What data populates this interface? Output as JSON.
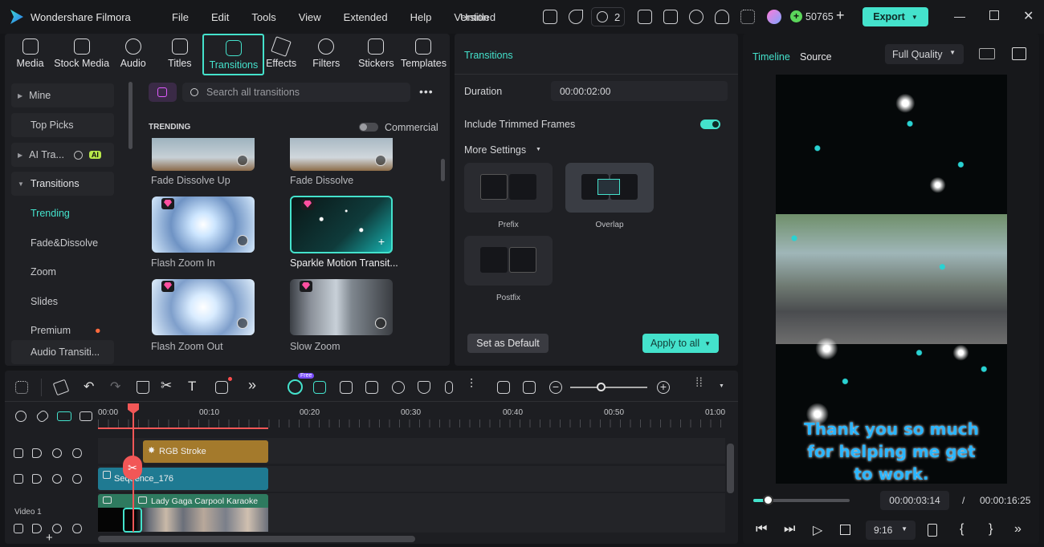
{
  "app": {
    "name": "Wondershare Filmora",
    "project": "Untitled"
  },
  "menu": [
    "File",
    "Edit",
    "Tools",
    "View",
    "Extended",
    "Help",
    "Version"
  ],
  "topbar": {
    "notification_count": "2",
    "credits": "50765",
    "export_label": "Export"
  },
  "media_tabs": [
    {
      "label": "Media",
      "icon": "media-icon"
    },
    {
      "label": "Stock Media",
      "icon": "stock-media-icon"
    },
    {
      "label": "Audio",
      "icon": "audio-icon"
    },
    {
      "label": "Titles",
      "icon": "titles-icon"
    },
    {
      "label": "Transitions",
      "icon": "transitions-icon"
    },
    {
      "label": "Effects",
      "icon": "effects-icon"
    },
    {
      "label": "Filters",
      "icon": "filters-icon"
    },
    {
      "label": "Stickers",
      "icon": "stickers-icon"
    },
    {
      "label": "Templates",
      "icon": "templates-icon"
    }
  ],
  "sidebar": {
    "items": [
      "Mine",
      "Top Picks",
      "AI Tra...",
      "Transitions",
      "Trending",
      "Fade&Dissolve",
      "Zoom",
      "Slides",
      "Premium",
      "Audio Transiti..."
    ],
    "ai_badge": "AI"
  },
  "library": {
    "search_placeholder": "Search all transitions",
    "section": "TRENDING",
    "commercial_label": "Commercial",
    "items": [
      "Fade Dissolve Up",
      "Fade Dissolve",
      "Flash Zoom In",
      "Sparkle Motion Transit...",
      "Flash Zoom Out",
      "Slow Zoom"
    ]
  },
  "props": {
    "title": "Transitions",
    "duration_label": "Duration",
    "duration_value": "00:00:02:00",
    "include_trimmed": "Include Trimmed Frames",
    "include_trimmed_on": true,
    "more_settings": "More Settings",
    "options": [
      "Prefix",
      "Overlap",
      "Postfix"
    ],
    "selected_option": "Overlap",
    "set_default": "Set as Default",
    "apply_all": "Apply to all"
  },
  "preview": {
    "tab_timeline": "Timeline",
    "tab_source": "Source",
    "quality": "Full Quality",
    "caption": [
      "Thank you so much",
      "for helping me get",
      "to work."
    ],
    "current_time": "00:00:03:14",
    "separator": "/",
    "total_time": "00:00:16:25",
    "aspect": "9:16",
    "progress": 0.16
  },
  "toolbar": {
    "free_badge": "Free"
  },
  "timeline": {
    "ruler": [
      "00:00",
      "00:10",
      "00:20",
      "00:30",
      "00:40",
      "00:50",
      "01:00"
    ],
    "clips": [
      {
        "name": "RGB Stroke",
        "color": "#a47a2c"
      },
      {
        "name": "Sequence_176",
        "color": "#1f7a92"
      },
      {
        "name": "Lady Gaga Carpool Karaoke",
        "color": "#2e7a5f"
      }
    ],
    "track_label": "Video 1"
  },
  "colors": {
    "accent": "#44e2cc",
    "playhead": "#f25757"
  }
}
